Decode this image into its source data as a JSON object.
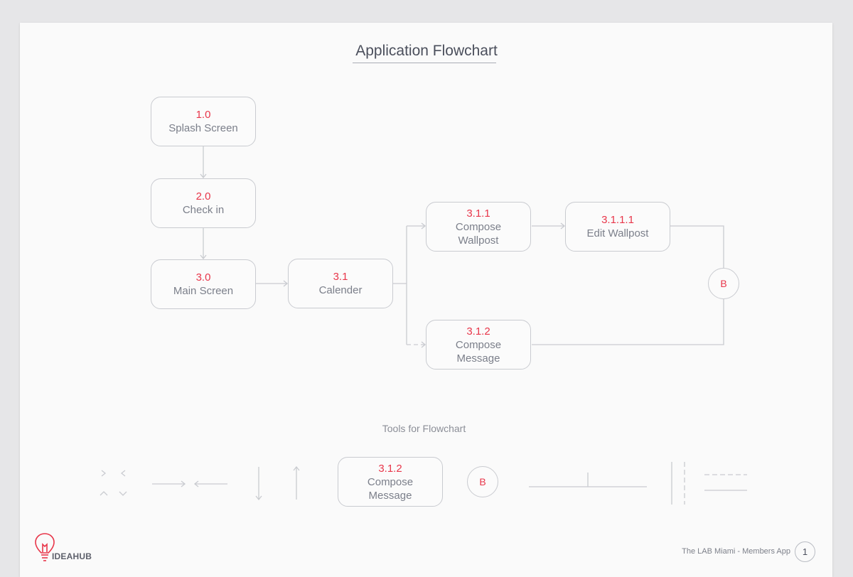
{
  "title": "Application Flowchart",
  "nodes": {
    "splash": {
      "num": "1.0",
      "label": "Splash Screen"
    },
    "checkin": {
      "num": "2.0",
      "label": "Check in"
    },
    "main": {
      "num": "3.0",
      "label": "Main Screen"
    },
    "calender": {
      "num": "3.1",
      "label": "Calender"
    },
    "compose_wallpost": {
      "num": "3.1.1",
      "label": "Compose\nWallpost"
    },
    "edit_wallpost": {
      "num": "3.1.1.1",
      "label": "Edit Wallpost"
    },
    "compose_message": {
      "num": "3.1.2",
      "label": "Compose\nMessage"
    }
  },
  "connector_label": "B",
  "tools": {
    "title": "Tools for Flowchart",
    "sample_node": {
      "num": "3.1.2",
      "label": "Compose\nMessage"
    },
    "sample_connector": "B"
  },
  "footer": {
    "brand": "IDEAHUB",
    "app_text": "The LAB Miami - Members App",
    "page_number": "1"
  },
  "colors": {
    "accent": "#e8364a",
    "line": "#c9cbd0",
    "text": "#7b7f8a"
  }
}
